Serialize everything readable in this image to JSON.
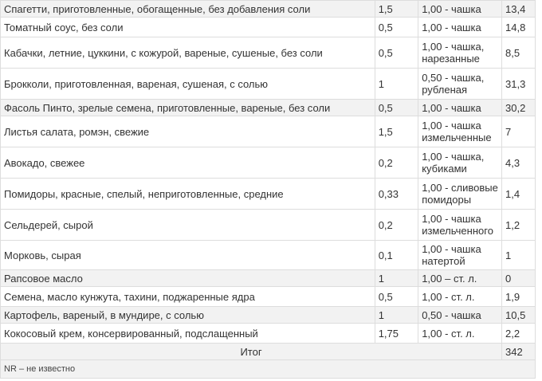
{
  "rows": [
    {
      "food": "Спагетти, приготовленные, обогащенные, без добавления соли",
      "amount": "1,5",
      "measure": "1,00 - чашка",
      "value": "13,4"
    },
    {
      "food": "Томатный соус, без соли",
      "amount": "0,5",
      "measure": "1,00 - чашка",
      "value": "14,8"
    },
    {
      "food": "Кабачки, летние, цуккини, с кожурой, вареные, сушеные, без соли",
      "amount": "0,5",
      "measure": "1,00 - чашка, нарезанные",
      "value": "8,5"
    },
    {
      "food": "Брокколи, приготовленная, вареная, сушеная, с солью",
      "amount": "1",
      "measure": "0,50 - чашка, рубленая",
      "value": "31,3"
    },
    {
      "food": "Фасоль Пинто, зрелые семена, приготовленные, вареные, без соли",
      "amount": "0,5",
      "measure": "1,00 - чашка",
      "value": "30,2"
    },
    {
      "food": "Листья салата, ромэн, свежие",
      "amount": "1,5",
      "measure": "1,00 - чашка измельченные",
      "value": "7"
    },
    {
      "food": "Авокадо, свежее",
      "amount": "0,2",
      "measure": "1,00 - чашка, кубиками",
      "value": "4,3"
    },
    {
      "food": "Помидоры, красные, спелый, неприготовленные, средние",
      "amount": "0,33",
      "measure": "1,00 - сливовые помидоры",
      "value": "1,4"
    },
    {
      "food": "Сельдерей, сырой",
      "amount": "0,2",
      "measure": "1,00 - чашка измельченного",
      "value": "1,2"
    },
    {
      "food": "Морковь, сырая",
      "amount": "0,1",
      "measure": "1,00 - чашка натертой",
      "value": "1"
    },
    {
      "food": "Рапсовое масло",
      "amount": "1",
      "measure": "1,00 – ст. л.",
      "value": "0"
    },
    {
      "food": "Семена, масло кунжута, тахини, поджаренные ядра",
      "amount": "0,5",
      "measure": "1,00 - ст. л.",
      "value": "1,9"
    },
    {
      "food": "Картофель, вареный, в мундире, с солью",
      "amount": "1",
      "measure": "0,50 - чашка",
      "value": "10,5"
    },
    {
      "food": "Кокосовый крем, консервированный, подслащенный",
      "amount": "1,75",
      "measure": "1,00 - ст. л.",
      "value": "2,2"
    }
  ],
  "total": {
    "label": "Итог",
    "value": "342"
  },
  "footnote": "NR – не известно"
}
